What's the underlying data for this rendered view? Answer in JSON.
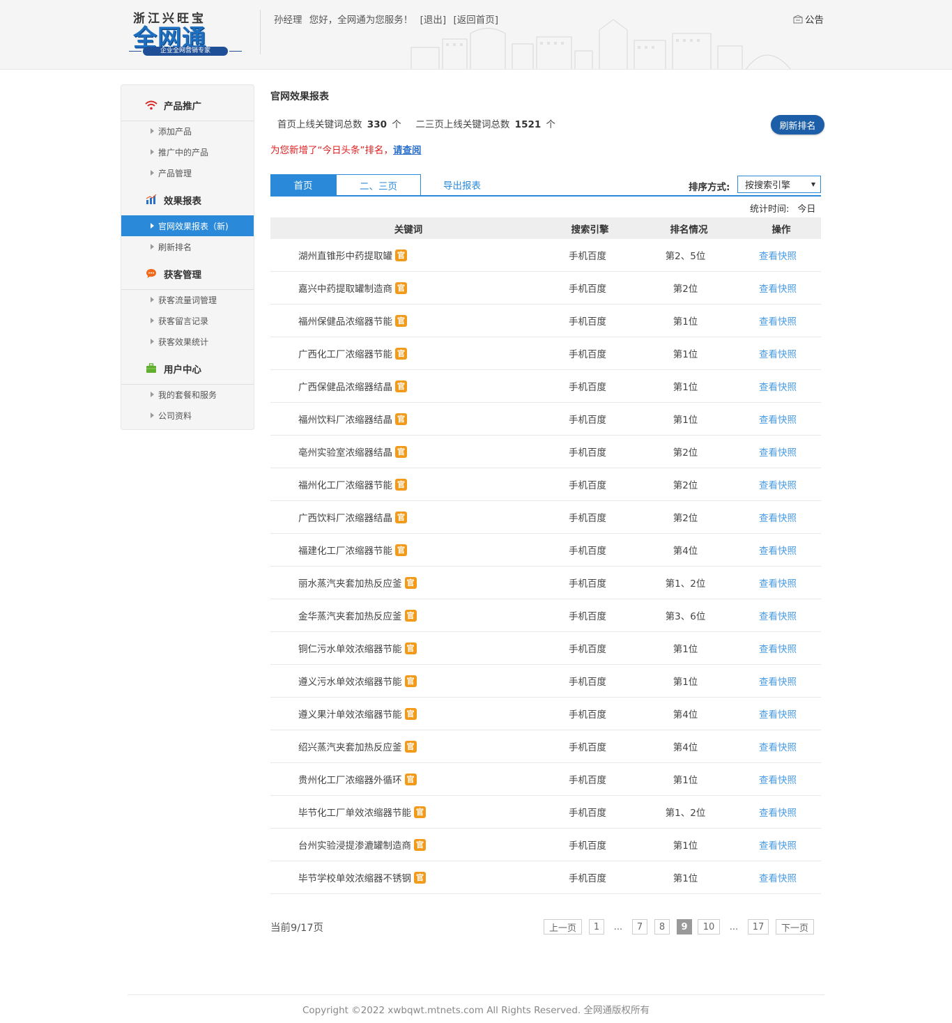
{
  "header": {
    "logo_top": "浙江兴旺宝",
    "logo_main": "全网通",
    "logo_sub": "企业全网营销专家",
    "greeting_name": "孙经理",
    "greeting_text": "您好，全网通为您服务！",
    "logout": "[退出]",
    "home": "[返回首页]",
    "notice": "公告"
  },
  "sidebar": {
    "sections": [
      {
        "title": "产品推广",
        "icon": "wifi-icon",
        "items": [
          "添加产品",
          "推广中的产品",
          "产品管理"
        ]
      },
      {
        "title": "效果报表",
        "icon": "chart-icon",
        "items": [
          "官网效果报表（新)",
          "刷新排名"
        ]
      },
      {
        "title": "获客管理",
        "icon": "chat-icon",
        "items": [
          "获客流量词管理",
          "获客留言记录",
          "获客效果统计"
        ]
      },
      {
        "title": "用户中心",
        "icon": "briefcase-icon",
        "items": [
          "我的套餐和服务",
          "公司资料"
        ]
      }
    ]
  },
  "main": {
    "title": "官网效果报表",
    "stats": {
      "first_label": "首页上线关键词总数",
      "first_value": "330",
      "first_unit": "个",
      "second_label": "二三页上线关键词总数",
      "second_value": "1521",
      "second_unit": "个"
    },
    "refresh_label": "刷新排名",
    "new_notice": "为您新增了“今日头条”排名，",
    "new_notice_link": "请查阅",
    "tabs": {
      "home": "首页",
      "pages23": "二、三页",
      "export": "导出报表"
    },
    "sort_label": "排序方式:",
    "sort_value": "按搜索引擎",
    "stat_time_label": "统计时间:",
    "stat_time_value": "今日"
  },
  "table": {
    "headers": [
      "关键词",
      "搜索引擎",
      "排名情况",
      "操作"
    ],
    "badge": "官",
    "action": "查看快照",
    "rows": [
      {
        "keyword": "湖州直锥形中药提取罐",
        "engine": "手机百度",
        "rank": "第2、5位"
      },
      {
        "keyword": "嘉兴中药提取罐制造商",
        "engine": "手机百度",
        "rank": "第2位"
      },
      {
        "keyword": "福州保健品浓缩器节能",
        "engine": "手机百度",
        "rank": "第1位"
      },
      {
        "keyword": "广西化工厂浓缩器节能",
        "engine": "手机百度",
        "rank": "第1位"
      },
      {
        "keyword": "广西保健品浓缩器结晶",
        "engine": "手机百度",
        "rank": "第1位"
      },
      {
        "keyword": "福州饮料厂浓缩器结晶",
        "engine": "手机百度",
        "rank": "第1位"
      },
      {
        "keyword": "亳州实验室浓缩器结晶",
        "engine": "手机百度",
        "rank": "第2位"
      },
      {
        "keyword": "福州化工厂浓缩器节能",
        "engine": "手机百度",
        "rank": "第2位"
      },
      {
        "keyword": "广西饮料厂浓缩器结晶",
        "engine": "手机百度",
        "rank": "第2位"
      },
      {
        "keyword": "福建化工厂浓缩器节能",
        "engine": "手机百度",
        "rank": "第4位"
      },
      {
        "keyword": "丽水蒸汽夹套加热反应釜",
        "engine": "手机百度",
        "rank": "第1、2位"
      },
      {
        "keyword": "金华蒸汽夹套加热反应釜",
        "engine": "手机百度",
        "rank": "第3、6位"
      },
      {
        "keyword": "铜仁污水单效浓缩器节能",
        "engine": "手机百度",
        "rank": "第1位"
      },
      {
        "keyword": "遵义污水单效浓缩器节能",
        "engine": "手机百度",
        "rank": "第1位"
      },
      {
        "keyword": "遵义果汁单效浓缩器节能",
        "engine": "手机百度",
        "rank": "第4位"
      },
      {
        "keyword": "绍兴蒸汽夹套加热反应釜",
        "engine": "手机百度",
        "rank": "第4位"
      },
      {
        "keyword": "贵州化工厂浓缩器外循环",
        "engine": "手机百度",
        "rank": "第1位"
      },
      {
        "keyword": "毕节化工厂单效浓缩器节能",
        "engine": "手机百度",
        "rank": "第1、2位"
      },
      {
        "keyword": "台州实验浸提渗漉罐制造商",
        "engine": "手机百度",
        "rank": "第1位"
      },
      {
        "keyword": "毕节学校单效浓缩器不锈钢",
        "engine": "手机百度",
        "rank": "第1位"
      }
    ]
  },
  "pagination": {
    "info": "当前9/17页",
    "prev": "上一页",
    "next": "下一页",
    "pages": [
      "1",
      "...",
      "7",
      "8",
      "9",
      "10",
      "...",
      "17"
    ],
    "current": "9"
  },
  "footer": {
    "copyright": "Copyright ©2022 xwbqwt.mtnets.com All Rights Reserved. 全网通版权所有"
  },
  "colors": {
    "accent": "#2a8ad9",
    "button": "#1c5ea8",
    "badge": "#f29a1a",
    "link": "#4a9be0",
    "alert": "#e02020"
  }
}
